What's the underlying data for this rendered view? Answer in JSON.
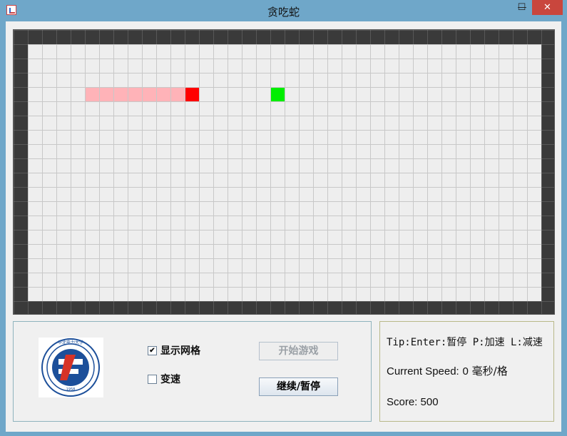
{
  "window": {
    "title": "贪吃蛇",
    "min_glyph": "—",
    "max_glyph": "☐",
    "close_glyph": "✕",
    "icon": "java-app-icon"
  },
  "game": {
    "cols": 36,
    "rows": 18,
    "snake_head": {
      "col": 11,
      "row": 3
    },
    "snake_body": [
      {
        "col": 4,
        "row": 3
      },
      {
        "col": 5,
        "row": 3
      },
      {
        "col": 6,
        "row": 3
      },
      {
        "col": 7,
        "row": 3
      },
      {
        "col": 8,
        "row": 3
      },
      {
        "col": 9,
        "row": 3
      },
      {
        "col": 10,
        "row": 3
      }
    ],
    "food": {
      "col": 17,
      "row": 3
    },
    "colors": {
      "head": "#ff0000",
      "body": "#ffb3b8",
      "food": "#00ee00",
      "wall": "#3a3a3a",
      "floor": "#eeeeee"
    }
  },
  "controls": {
    "show_grid_label": "显示网格",
    "show_grid_checked": true,
    "speed_change_label": "变速",
    "speed_change_checked": false,
    "start_label": "开始游戏",
    "pause_label": "继续/暂停"
  },
  "status": {
    "tip": "Tip:Enter:暂停 P:加速 L:减速",
    "speed_label": "Current Speed:",
    "speed_value": "0",
    "speed_unit": "毫秒/格",
    "score_label": "Score:",
    "score_value": "500"
  },
  "logo": {
    "top_text": "华北电力大学",
    "ring_text": "NORTH CHINA ELECTRIC POWER UNIVERSITY",
    "year": "1958"
  }
}
